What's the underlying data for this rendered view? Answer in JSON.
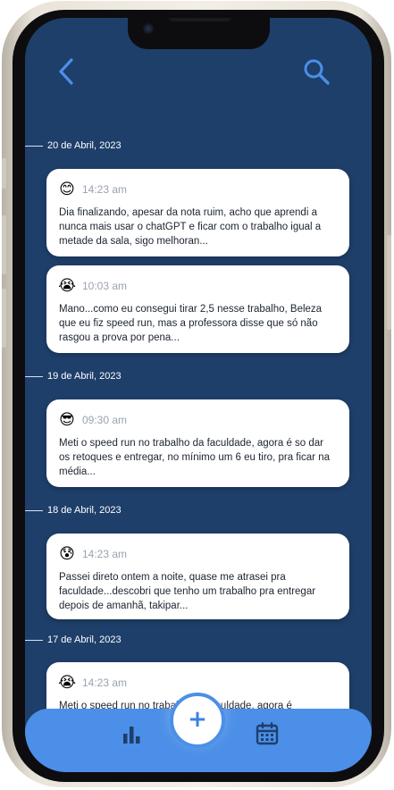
{
  "header": {
    "back_icon": "chevron-left-icon",
    "search_icon": "search-icon"
  },
  "feed": [
    {
      "date": "20 de Abril, 2023",
      "entries": [
        {
          "emoji": "😊",
          "emoji_name": "smiling-face-icon",
          "time": "14:23 am",
          "text": "Dia finalizando, apesar da nota ruim, acho que aprendi a nunca mais usar o chatGPT e ficar com o trabalho igual a metade da sala, sigo melhoran..."
        },
        {
          "emoji": "😭",
          "emoji_name": "crying-face-icon",
          "time": "10:03 am",
          "text": "Mano...como eu consegui tirar 2,5 nesse trabalho, Beleza que eu fiz speed run, mas a professora disse que só não rasgou a prova por pena..."
        }
      ]
    },
    {
      "date": "19 de Abril, 2023",
      "entries": [
        {
          "emoji": "😎",
          "emoji_name": "sunglasses-face-icon",
          "time": "09:30 am",
          "text": "Meti o speed run no trabalho da faculdade, agora é so dar os retoques e entregar, no mínimo um 6 eu tiro, pra ficar na média..."
        }
      ]
    },
    {
      "date": "18 de Abril, 2023",
      "entries": [
        {
          "emoji": "😰",
          "emoji_name": "anxious-face-icon",
          "time": "14:23 am",
          "text": "Passei direto ontem a noite, quase me atrasei pra faculdade...descobri que tenho um trabalho pra entregar depois de amanhã, takipar..."
        }
      ]
    },
    {
      "date": "17 de Abril, 2023",
      "entries": [
        {
          "emoji": "😭",
          "emoji_name": "crying-face-icon",
          "time": "14:23 am",
          "text": "Meti o speed run no trabalho da faculdade, agora é"
        }
      ]
    }
  ],
  "tabbar": {
    "stats_icon": "bar-chart-icon",
    "add_label": "+",
    "calendar_icon": "calendar-icon"
  },
  "colors": {
    "background": "#1e3f6a",
    "accent": "#4b8fe8",
    "card": "#ffffff"
  }
}
